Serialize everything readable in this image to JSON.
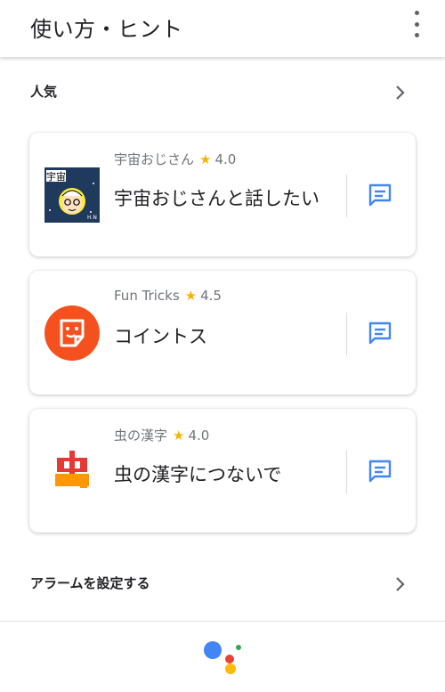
{
  "header": {
    "title": "使い方・ヒント",
    "menu_icon": "more-vert-icon"
  },
  "sections": {
    "popular": {
      "label": "人気",
      "icon": "chevron-right-icon"
    },
    "alarm": {
      "label": "アラームを設定する",
      "icon": "chevron-right-icon"
    }
  },
  "cards": [
    {
      "provider": "宇宙おじさん",
      "rating": "4.0",
      "title": "宇宙おじさんと話したい",
      "icon": "uchu-ojisan-avatar"
    },
    {
      "provider": "Fun Tricks",
      "rating": "4.5",
      "title": "コイントス",
      "icon": "fun-tricks-sticker-icon"
    },
    {
      "provider": "虫の漢字",
      "rating": "4.0",
      "title": "虫の漢字につないで",
      "icon": "mushi-kanji-icon"
    }
  ],
  "star_glyph": "★",
  "action_icon": "chat-icon",
  "colors": {
    "accent_blue": "#4285f4",
    "star": "#f4b400",
    "fun_tricks": "#f4511e"
  },
  "footer": {
    "logo": "google-assistant-icon"
  }
}
